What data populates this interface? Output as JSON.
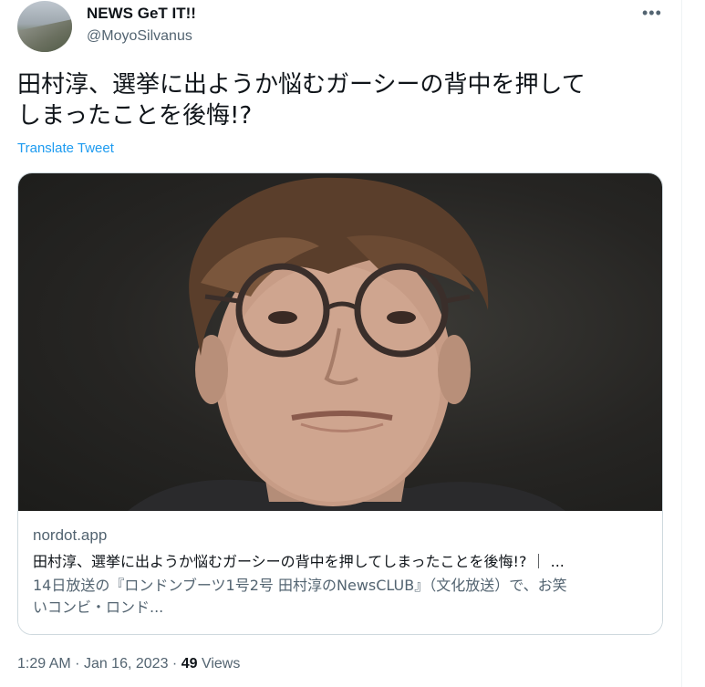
{
  "author": {
    "name": "NEWS GeT IT!!",
    "handle": "@MoyoSilvanus"
  },
  "more_icon": "more-dots-icon",
  "tweet": {
    "text_line1": "田村淳、選挙に出ようか悩むガーシーの背中を押して",
    "text_line2": "しまったことを後悔!?",
    "translate_label": "Translate Tweet"
  },
  "card": {
    "domain": "nordot.app",
    "title": "田村淳、選挙に出ようか悩むガーシーの背中を押してしまったことを後悔!? ｜ ...",
    "desc_line1": "14日放送の『ロンドンブーツ1号2号 田村淳のNewsCLUB』（文化放送）で、お笑",
    "desc_line2": "いコンビ・ロンド..."
  },
  "meta": {
    "time": "1:29 AM",
    "sep1": "·",
    "date": "Jan 16, 2023",
    "sep2": "·",
    "views_count": "49",
    "views_label": "Views"
  },
  "colors": {
    "link": "#1d9bf0",
    "secondary": "#536471",
    "text": "#0f1419",
    "border": "#cfd9de"
  }
}
